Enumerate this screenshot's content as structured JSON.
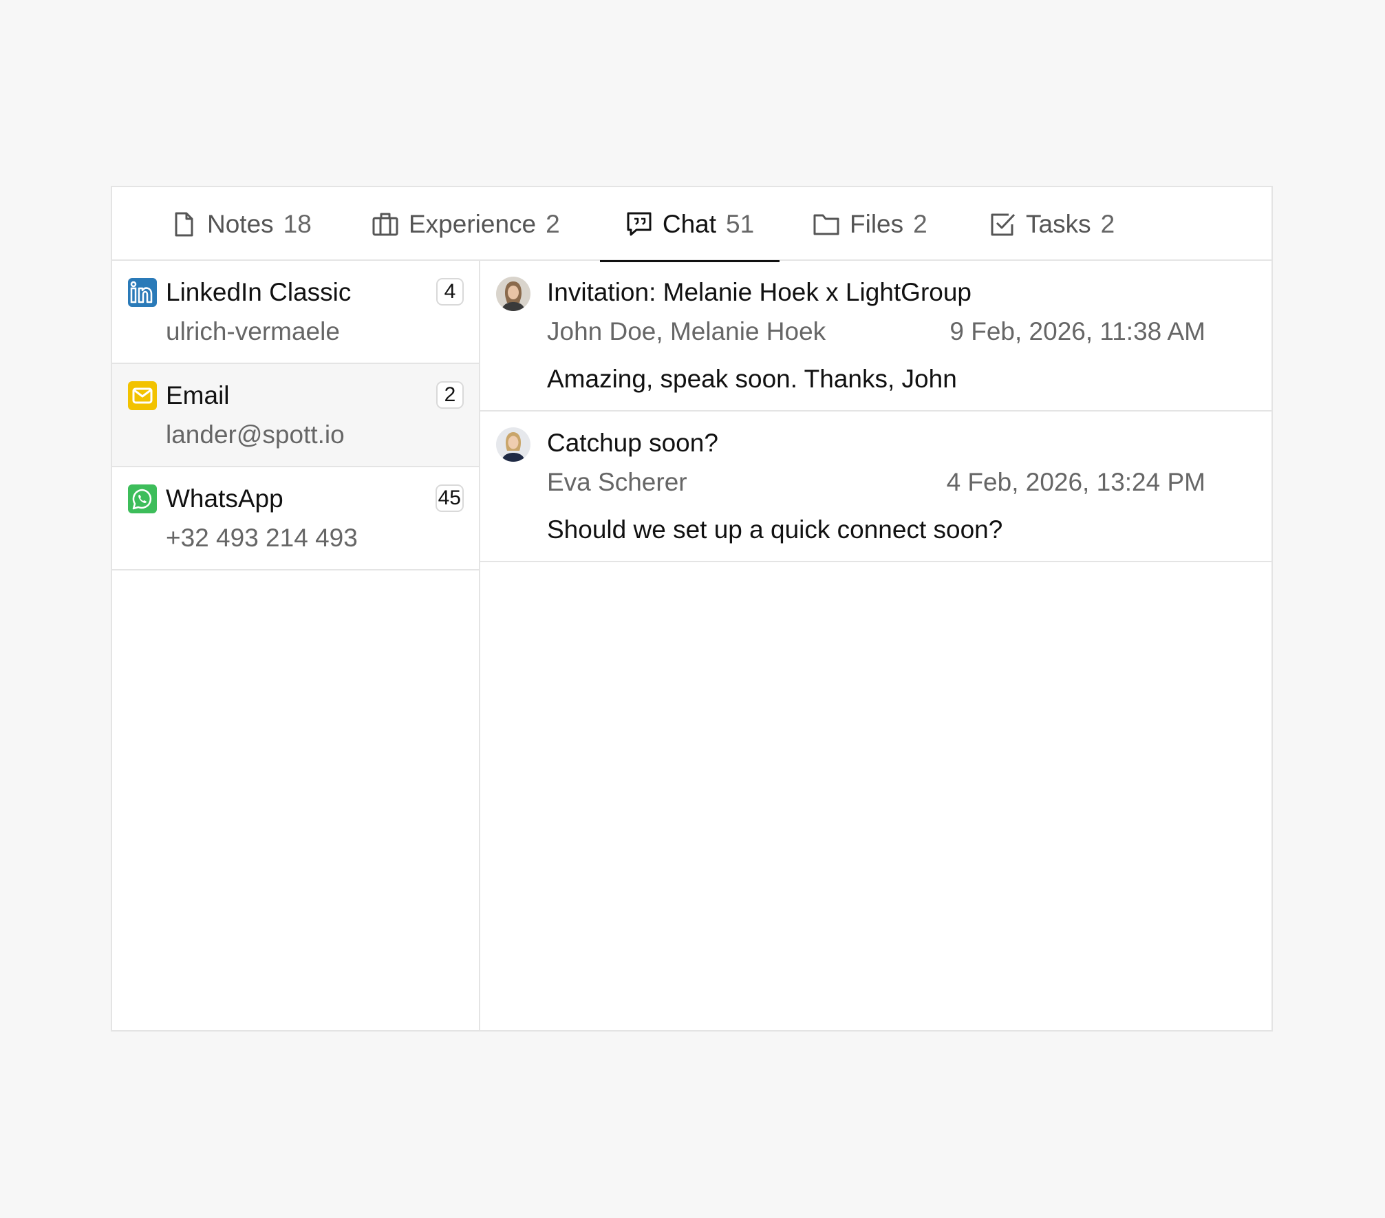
{
  "tabs": [
    {
      "label": "Notes",
      "count": "18",
      "icon": "document-icon",
      "active": false
    },
    {
      "label": "Experience",
      "count": "2",
      "icon": "briefcase-icon",
      "active": false
    },
    {
      "label": "Chat",
      "count": "51",
      "icon": "chat-icon",
      "active": true
    },
    {
      "label": "Files",
      "count": "2",
      "icon": "folder-icon",
      "active": false
    },
    {
      "label": "Tasks",
      "count": "2",
      "icon": "checkbox-icon",
      "active": false
    }
  ],
  "channels": [
    {
      "name": "LinkedIn Classic",
      "sub": "ulrich-vermaele",
      "count": "4",
      "icon": "linkedin-icon",
      "color": "#2a7ab8",
      "selected": false
    },
    {
      "name": "Email",
      "sub": "lander@spott.io",
      "count": "2",
      "icon": "mail-icon",
      "color": "#f2c200",
      "selected": true
    },
    {
      "name": "WhatsApp",
      "sub": "+32 493 214 493",
      "count": "45",
      "icon": "whatsapp-icon",
      "color": "#3dbd5a",
      "selected": false
    }
  ],
  "messages": [
    {
      "title": "Invitation: Melanie Hoek x LightGroup",
      "participants": "John Doe, Melanie Hoek",
      "date": "9 Feb, 2026, 11:38 AM",
      "preview": "Amazing, speak soon. Thanks, John",
      "avatar": "avatar-melanie"
    },
    {
      "title": "Catchup soon?",
      "participants": "Eva Scherer",
      "date": "4 Feb, 2026, 13:24 PM",
      "preview": "Should we set up a quick connect soon?",
      "avatar": "avatar-eva"
    }
  ],
  "colors": {
    "background": "#f7f7f7",
    "border": "#e4e4e4",
    "text": "#111111",
    "muted": "#666666",
    "selected_row": "#f6f6f6"
  }
}
